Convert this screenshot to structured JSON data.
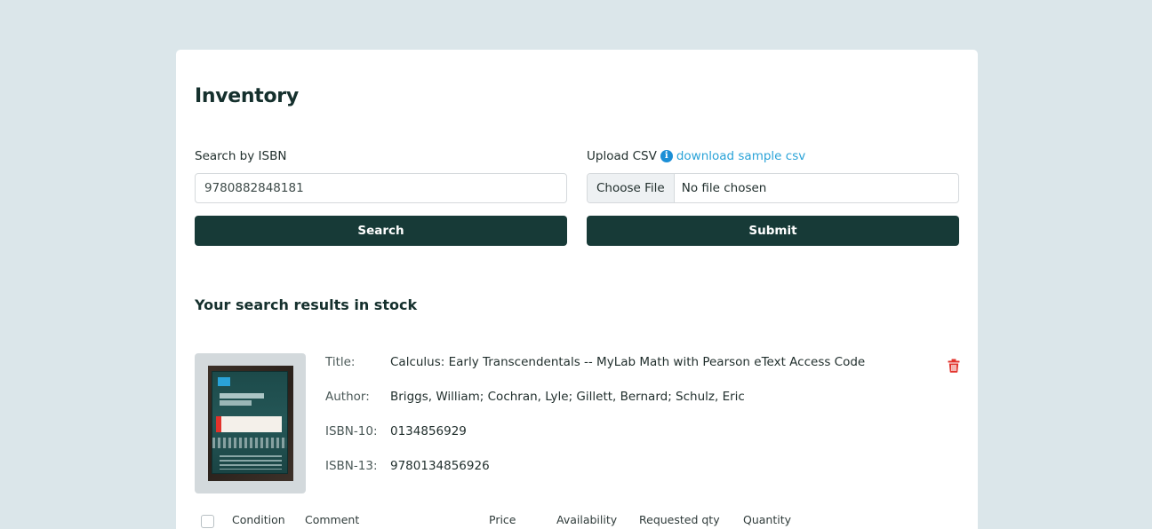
{
  "page": {
    "title": "Inventory"
  },
  "search": {
    "label": "Search by ISBN",
    "value": "9780882848181",
    "button_label": "Search"
  },
  "upload": {
    "label": "Upload CSV",
    "info_icon": "info-icon",
    "sample_link": "download sample csv",
    "choose_file_label": "Choose File",
    "file_status": "No file chosen",
    "button_label": "Submit"
  },
  "results": {
    "heading": "Your search results in stock",
    "book": {
      "title_label": "Title:",
      "title": "Calculus: Early Transcendentals -- MyLab Math with Pearson eText Access Code",
      "author_label": "Author:",
      "author": "Briggs, William; Cochran, Lyle; Gillett, Bernard; Schulz, Eric",
      "isbn10_label": "ISBN-10:",
      "isbn10": "0134856929",
      "isbn13_label": "ISBN-13:",
      "isbn13": "9780134856926",
      "delete_icon": "trash-icon"
    },
    "table_headers": [
      "Condition",
      "Comment",
      "Price",
      "Availability",
      "Requested qty",
      "Quantity"
    ]
  },
  "colors": {
    "background": "#dbe6ea",
    "card": "#ffffff",
    "primary_button": "#173a37",
    "link": "#2aa3d8",
    "info_icon": "#1b8fd6",
    "delete": "#e2332c"
  }
}
